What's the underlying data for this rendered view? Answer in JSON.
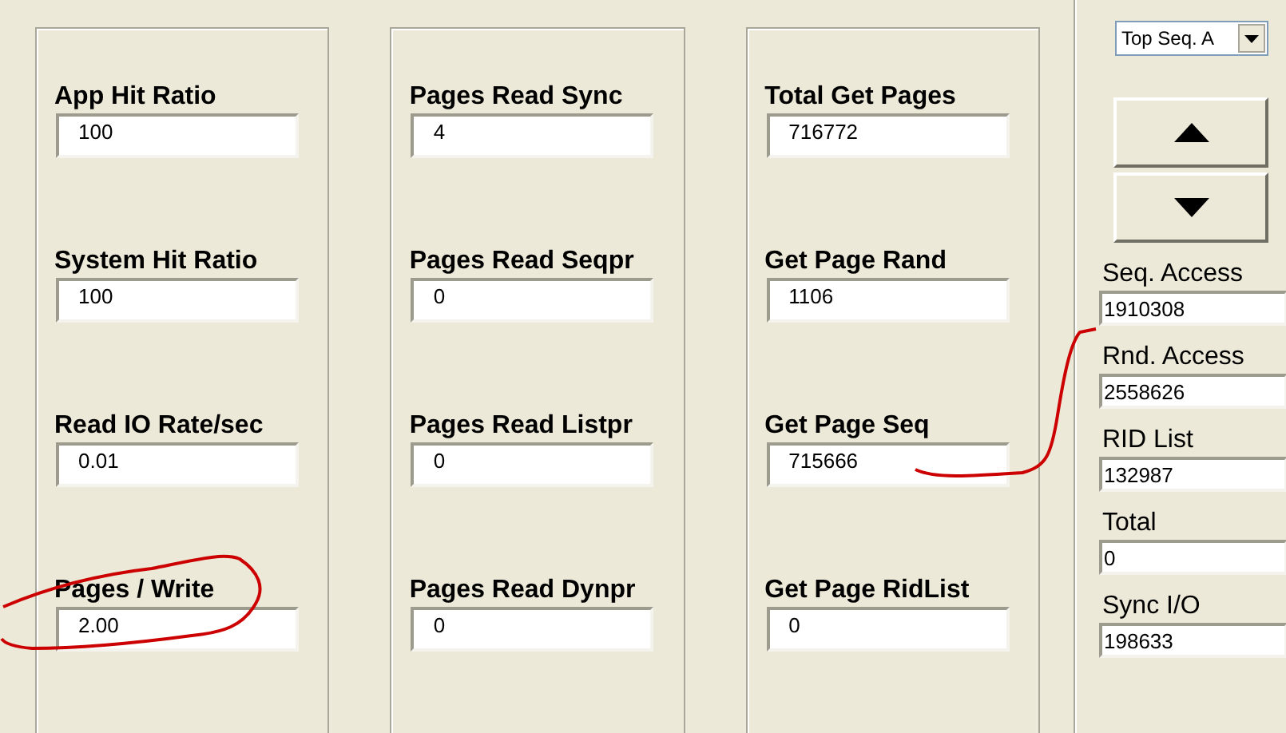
{
  "panels": [
    {
      "fields": [
        {
          "label": "App Hit Ratio",
          "value": "100"
        },
        {
          "label": "System Hit Ratio",
          "value": "100"
        },
        {
          "label": "Read IO Rate/sec",
          "value": "0.01"
        },
        {
          "label": "Pages / Write",
          "value": "2.00"
        }
      ]
    },
    {
      "fields": [
        {
          "label": "Pages Read Sync",
          "value": "4"
        },
        {
          "label": "Pages Read Seqpr",
          "value": "0"
        },
        {
          "label": "Pages Read Listpr",
          "value": "0"
        },
        {
          "label": "Pages Read Dynpr",
          "value": "0"
        }
      ]
    },
    {
      "fields": [
        {
          "label": "Total Get Pages",
          "value": "716772"
        },
        {
          "label": "Get Page Rand",
          "value": "1106"
        },
        {
          "label": "Get Page Seq",
          "value": "715666"
        },
        {
          "label": "Get Page RidList",
          "value": "0"
        }
      ]
    }
  ],
  "sidebar": {
    "dropdown": {
      "value": "Top Seq. A"
    },
    "buttons": [
      {
        "kind": "up"
      },
      {
        "kind": "down"
      }
    ],
    "stats": [
      {
        "label": "Seq. Access",
        "value": "1910308"
      },
      {
        "label": "Rnd. Access",
        "value": "2558626"
      },
      {
        "label": "RID List",
        "value": "132987"
      },
      {
        "label": "Total",
        "value": "0"
      },
      {
        "label": "Sync I/O",
        "value": "198633"
      }
    ]
  }
}
